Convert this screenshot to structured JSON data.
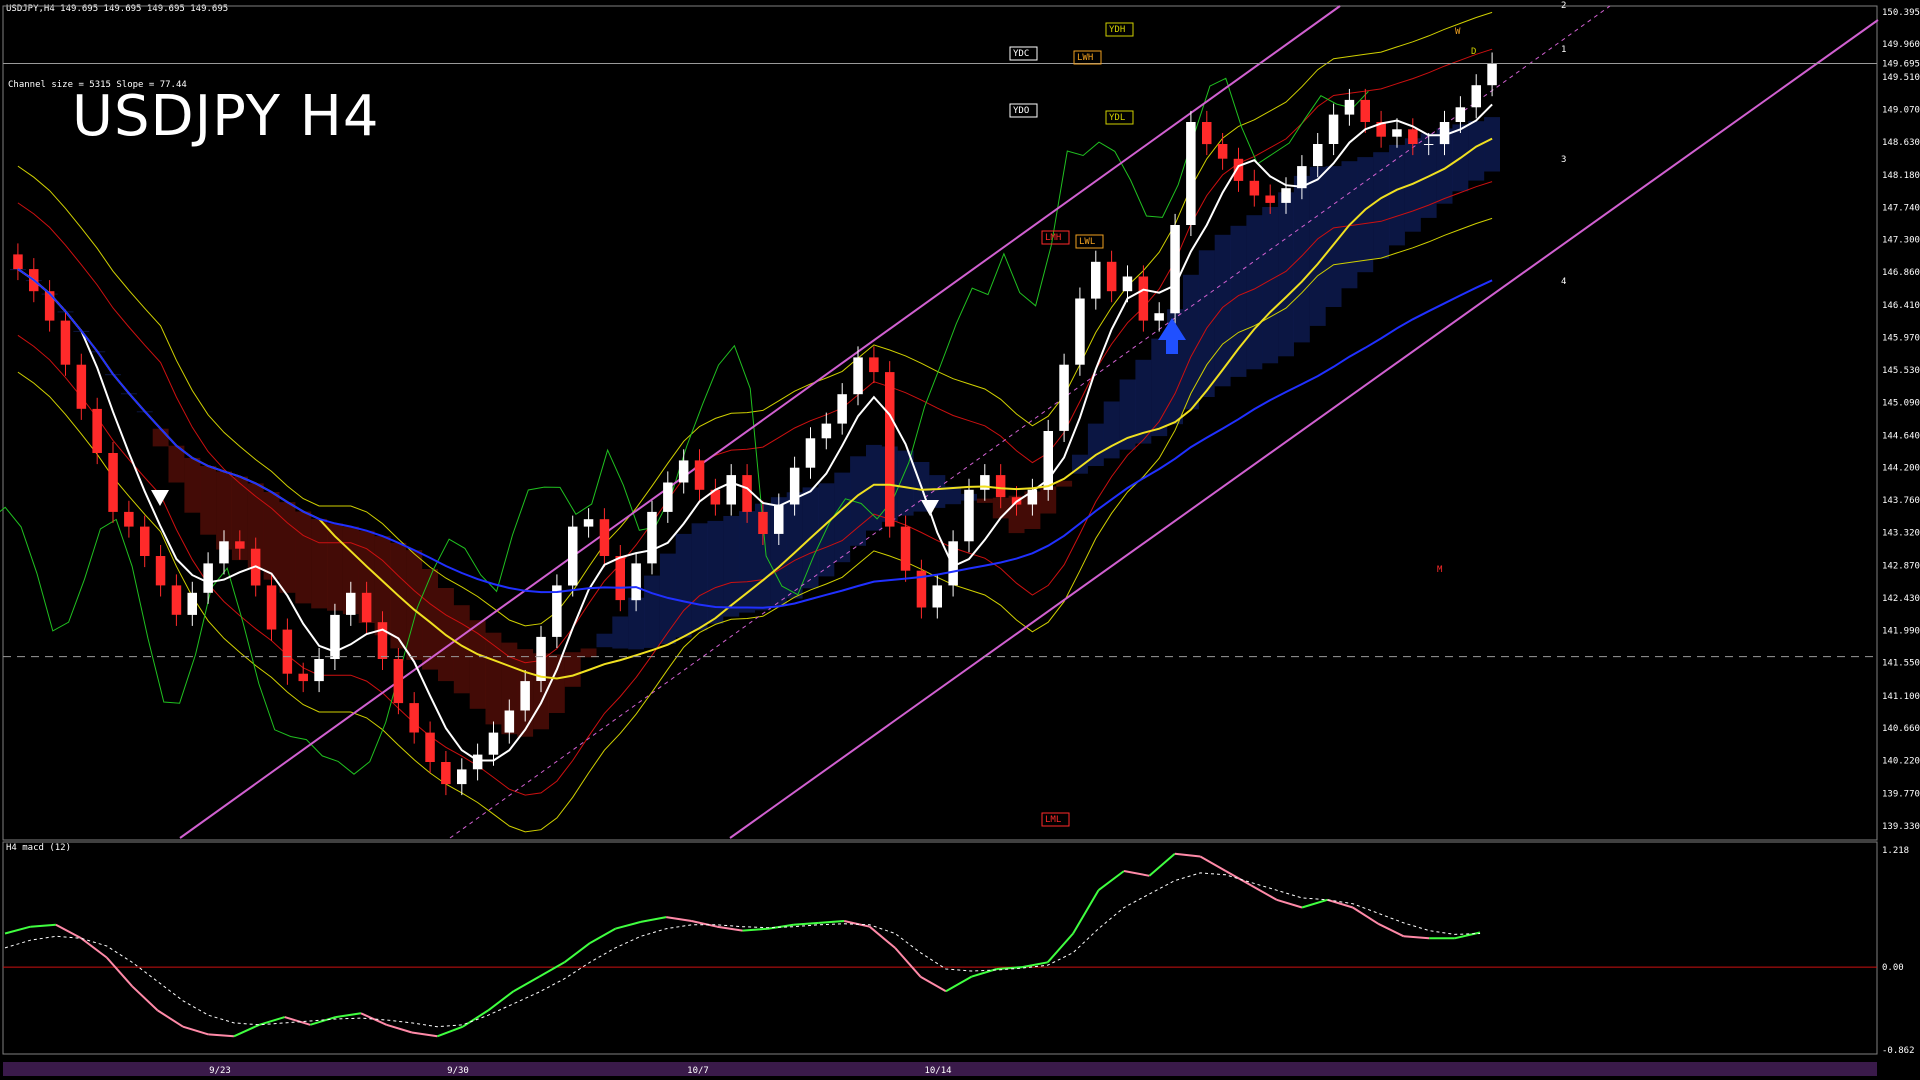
{
  "header": {
    "symbol_line": "USDJPY,H4  149.695 149.695 149.695 149.695",
    "channel_info": "Channel size = 5315 Slope = 77.44",
    "big_title": "USDJPY H4",
    "macd_label": "H4 macd (12)"
  },
  "colors": {
    "bg": "#000000",
    "grid": "#3a3a3a",
    "bull": "#ffffff",
    "bear": "#ff2a2a",
    "sma_white": "#ffffff",
    "sma_yellow": "#f0e020",
    "sma_blue": "#2030ff",
    "channel": "#d060d0",
    "ichimoku_cloud_bull": "#2040c0",
    "ichimoku_cloud_bear": "#c02010",
    "chikou": "#20c020",
    "bands": "#d0d000",
    "inner_bands": "#cc1010",
    "macd_up": "#40ff40",
    "macd_down": "#ff8aa8",
    "macd_zero": "#cc1010"
  },
  "chart_data": [
    {
      "type": "line",
      "title": "USDJPY H4",
      "price_axis_ticks": [
        "150.395",
        "149.960",
        "149.510",
        "149.070",
        "148.630",
        "148.180",
        "147.740",
        "147.300",
        "146.860",
        "146.410",
        "145.970",
        "145.530",
        "145.090",
        "144.640",
        "144.200",
        "143.760",
        "143.320",
        "142.870",
        "142.430",
        "141.990",
        "141.550",
        "141.100",
        "140.660",
        "140.220",
        "139.770",
        "139.330"
      ],
      "current_price": "149.695",
      "dashed_level": "141.633",
      "ylim": [
        139.33,
        150.395
      ],
      "date_labels": [
        "9/23",
        "9/30",
        "10/7",
        "10/14"
      ],
      "candles_close_approx": [
        146.9,
        146.6,
        146.2,
        145.6,
        145.0,
        144.4,
        143.6,
        143.4,
        143.0,
        142.6,
        142.2,
        142.5,
        142.9,
        143.2,
        143.1,
        142.6,
        142.0,
        141.4,
        141.3,
        141.6,
        142.2,
        142.5,
        142.1,
        141.6,
        141.0,
        140.6,
        140.2,
        139.9,
        140.1,
        140.3,
        140.6,
        140.9,
        141.3,
        141.9,
        142.6,
        143.4,
        143.5,
        143.0,
        142.4,
        142.9,
        143.6,
        144.0,
        144.3,
        143.9,
        143.7,
        144.1,
        143.6,
        143.3,
        143.7,
        144.2,
        144.6,
        144.8,
        145.2,
        145.7,
        145.5,
        143.4,
        142.8,
        142.3,
        142.6,
        143.2,
        143.9,
        144.1,
        143.8,
        143.7,
        143.9,
        144.7,
        145.6,
        146.5,
        147.0,
        146.6,
        146.8,
        146.2,
        146.3,
        147.5,
        148.9,
        148.6,
        148.4,
        148.1,
        147.9,
        147.8,
        148.0,
        148.3,
        148.6,
        149.0,
        149.2,
        148.9,
        148.7,
        148.8,
        148.6,
        148.6,
        148.9,
        149.1,
        149.4,
        149.695
      ],
      "annotations": [
        "YDH",
        "YDC",
        "LWH",
        "YDO",
        "YDL",
        "LMH",
        "LWL",
        "LML",
        "M",
        "W",
        "D",
        "1",
        "2",
        "3",
        "4"
      ]
    },
    {
      "type": "line",
      "title": "H4 macd (12)",
      "macd_axis_ticks": [
        "1.218",
        "0.00",
        "-0.862"
      ],
      "ylim": [
        -0.862,
        1.218
      ],
      "series": [
        {
          "name": "macd",
          "values": [
            0.35,
            0.42,
            0.44,
            0.3,
            0.1,
            -0.2,
            -0.45,
            -0.62,
            -0.7,
            -0.72,
            -0.6,
            -0.52,
            -0.6,
            -0.52,
            -0.48,
            -0.6,
            -0.68,
            -0.72,
            -0.62,
            -0.45,
            -0.25,
            -0.1,
            0.05,
            0.25,
            0.4,
            0.47,
            0.52,
            0.48,
            0.42,
            0.38,
            0.4,
            0.44,
            0.46,
            0.48,
            0.42,
            0.2,
            -0.1,
            -0.25,
            -0.1,
            -0.02,
            0.0,
            0.05,
            0.35,
            0.8,
            1.0,
            0.95,
            1.18,
            1.15,
            1.0,
            0.85,
            0.7,
            0.62,
            0.7,
            0.62,
            0.45,
            0.32,
            0.3,
            0.3,
            0.36
          ]
        },
        {
          "name": "signal",
          "values": [
            0.2,
            0.28,
            0.32,
            0.3,
            0.22,
            0.05,
            -0.15,
            -0.35,
            -0.5,
            -0.58,
            -0.6,
            -0.58,
            -0.56,
            -0.54,
            -0.53,
            -0.55,
            -0.58,
            -0.62,
            -0.6,
            -0.5,
            -0.38,
            -0.26,
            -0.12,
            0.05,
            0.2,
            0.32,
            0.4,
            0.44,
            0.44,
            0.42,
            0.41,
            0.42,
            0.44,
            0.45,
            0.44,
            0.35,
            0.15,
            -0.02,
            -0.04,
            -0.03,
            -0.01,
            0.02,
            0.15,
            0.4,
            0.62,
            0.76,
            0.9,
            0.98,
            0.96,
            0.88,
            0.8,
            0.72,
            0.7,
            0.66,
            0.56,
            0.46,
            0.38,
            0.34,
            0.35
          ]
        }
      ]
    }
  ]
}
